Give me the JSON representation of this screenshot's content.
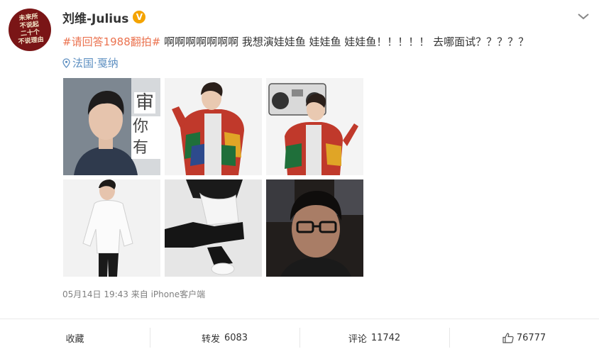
{
  "user": {
    "avatar_text": "未来所\n不说起\n二十个\n不说理由",
    "name": "刘维-Julius",
    "verified_mark": "V"
  },
  "post": {
    "hashtag": "#请回答1988翻拍#",
    "text": " 啊啊啊啊啊啊啊 我想演娃娃鱼 娃娃鱼 娃娃鱼！！！！！ 去哪面试？？？？？ ",
    "location": "法国·戛纳",
    "photos": [
      "portrait-photo",
      "colorful-cardigan-photo",
      "boombox-photo",
      "white-shirt-photo",
      "sitting-pose-photo",
      "car-selfie-photo"
    ],
    "photo1_overlay": [
      "审",
      "你有"
    ],
    "meta": "05月14日 19:43 来自 iPhone客户端"
  },
  "actions": {
    "favorite": "收藏",
    "repost_label": "转发",
    "repost_count": "6083",
    "comment_label": "评论",
    "comment_count": "11742",
    "like_count": "76777"
  },
  "colors": {
    "hashtag": "#eb7350",
    "location": "#5d8fc1",
    "verified": "#f4a300"
  }
}
